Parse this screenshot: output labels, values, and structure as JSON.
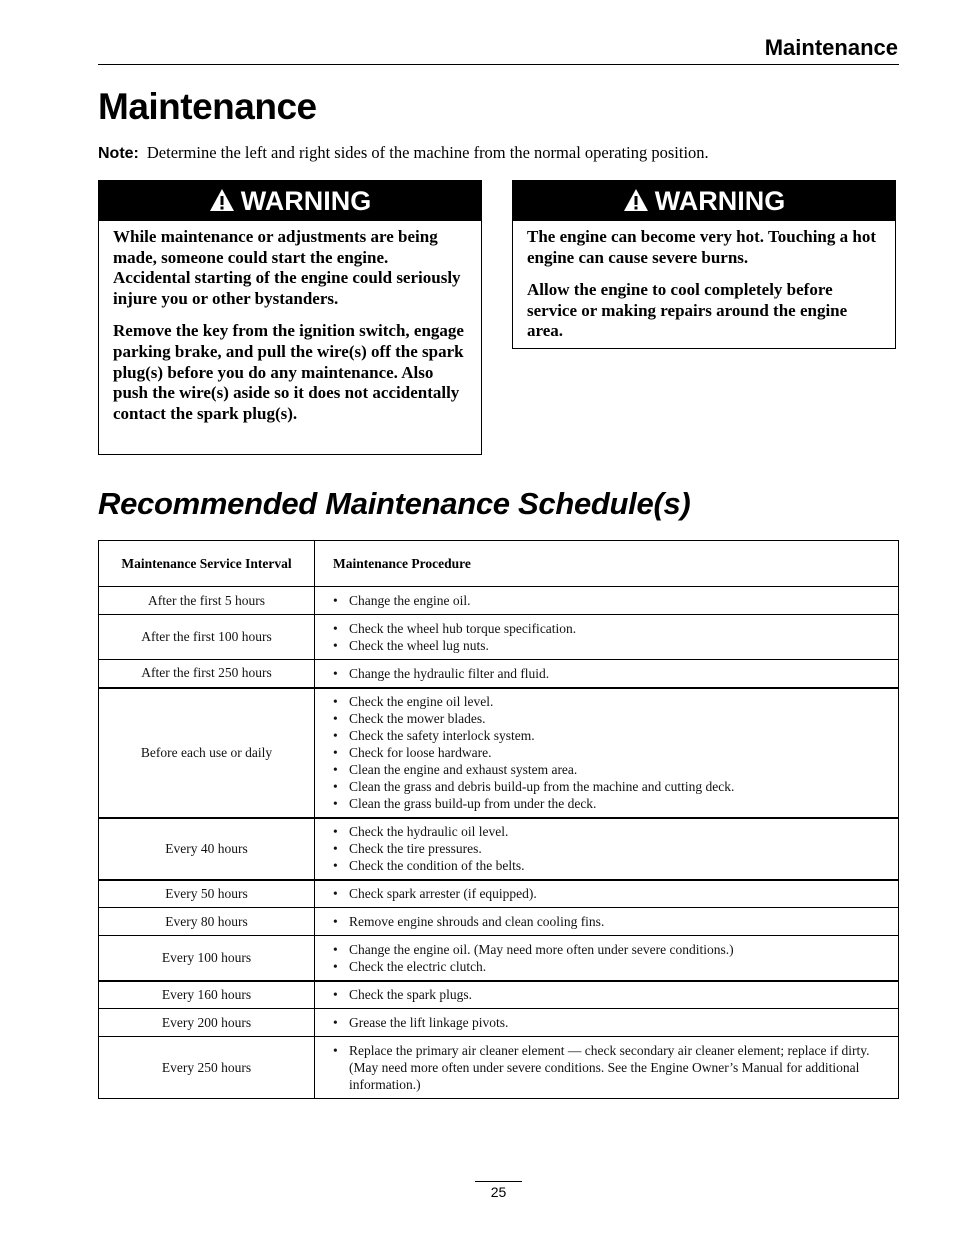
{
  "running_header": "Maintenance",
  "page_title": "Maintenance",
  "note": {
    "label": "Note:",
    "text": "Determine the left and right sides of the machine from the normal operating position."
  },
  "warnings": [
    {
      "icon": "warning-triangle-icon",
      "title": "WARNING",
      "paragraphs": [
        "While maintenance or adjustments are being made, someone could start the engine. Accidental starting of the engine could seriously injure you or other bystanders.",
        "Remove the key from the ignition switch, engage parking brake, and pull the wire(s) off the spark plug(s) before you do any maintenance.  Also push the wire(s) aside so it does not accidentally contact the spark plug(s)."
      ]
    },
    {
      "icon": "warning-triangle-icon",
      "title": "WARNING",
      "paragraphs": [
        "The engine can become very hot.  Touching a hot engine can cause severe burns.",
        "Allow the engine to cool completely before service or making repairs around the engine area."
      ]
    }
  ],
  "section_title": "Recommended Maintenance Schedule(s)",
  "schedule": {
    "headers": {
      "interval": "Maintenance Service Interval",
      "procedure": "Maintenance Procedure"
    },
    "rows": [
      {
        "interval": "After the first 5 hours",
        "procedures": [
          "Change the engine oil."
        ]
      },
      {
        "interval": "After the first 100 hours",
        "procedures": [
          "Check the wheel hub torque specification.",
          "Check the wheel lug nuts."
        ]
      },
      {
        "interval": "After the first 250 hours",
        "procedures": [
          "Change the hydraulic filter and fluid."
        ]
      },
      {
        "interval": "Before each use or daily",
        "procedures": [
          "Check the engine oil level.",
          "Check the mower blades.",
          "Check the safety interlock system.",
          "Check for loose hardware.",
          "Clean the engine and exhaust system area.",
          "Clean the grass and debris build-up from the machine and cutting deck.",
          "Clean the grass build-up from under the deck."
        ]
      },
      {
        "interval": "Every 40 hours",
        "procedures": [
          "Check the hydraulic oil level.",
          "Check the tire pressures.",
          "Check the condition of the belts."
        ]
      },
      {
        "interval": "Every 50 hours",
        "procedures": [
          "Check spark arrester (if equipped)."
        ]
      },
      {
        "interval": "Every 80 hours",
        "procedures": [
          "Remove engine shrouds and clean cooling fins."
        ]
      },
      {
        "interval": "Every 100 hours",
        "procedures": [
          "Change the engine oil.  (May need more often under severe conditions.)",
          "Check the electric clutch."
        ]
      },
      {
        "interval": "Every 160 hours",
        "procedures": [
          "Check the spark plugs."
        ]
      },
      {
        "interval": "Every 200 hours",
        "procedures": [
          "Grease the lift linkage pivots."
        ]
      },
      {
        "interval": "Every 250 hours",
        "procedures": [
          "Replace the primary air cleaner element — check secondary air cleaner element; replace if dirty.  (May need more often under severe conditions.  See the Engine Owner’s Manual for additional information.)"
        ]
      }
    ]
  },
  "page_number": "25"
}
